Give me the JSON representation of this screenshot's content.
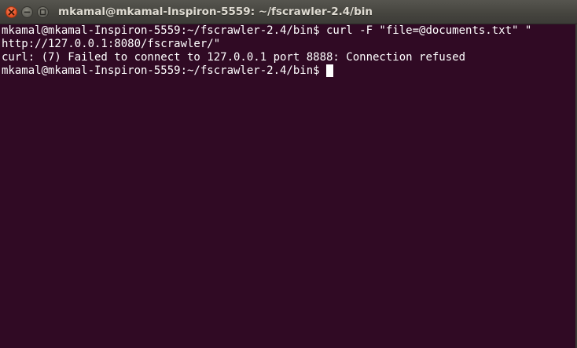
{
  "window": {
    "title": "mkamal@mkamal-Inspiron-5559: ~/fscrawler-2.4/bin",
    "buttons": {
      "close_icon": "close-icon",
      "minimize_icon": "minimize-icon",
      "maximize_icon": "maximize-icon"
    }
  },
  "terminal": {
    "background": "#300a24",
    "foreground": "#ffffff",
    "lines": [
      "mkamal@mkamal-Inspiron-5559:~/fscrawler-2.4/bin$ curl -F \"file=@documents.txt\" \"",
      "http://127.0.0.1:8080/fscrawler/\"",
      "curl: (7) Failed to connect to 127.0.0.1 port 8888: Connection refused",
      "mkamal@mkamal-Inspiron-5559:~/fscrawler-2.4/bin$"
    ]
  }
}
